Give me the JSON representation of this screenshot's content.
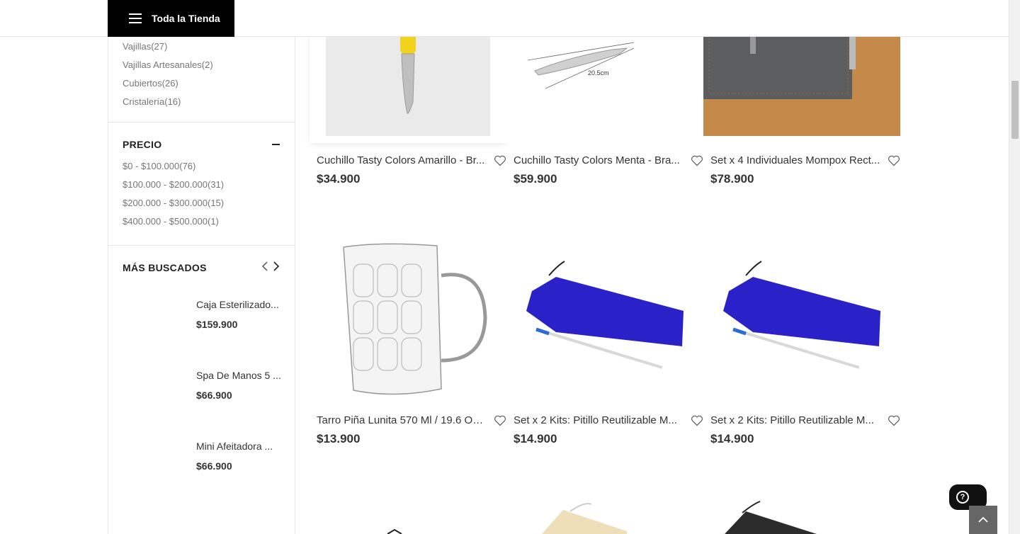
{
  "header": {
    "store_button": "Toda la Tienda"
  },
  "categories": [
    {
      "name": "Vajillas",
      "count": "(27)"
    },
    {
      "name": "Vajillas Artesanales",
      "count": "(2)"
    },
    {
      "name": "Cubiertos",
      "count": "(26)"
    },
    {
      "name": "Cristalería",
      "count": "(16)"
    }
  ],
  "price_filter": {
    "title": "PRECIO",
    "ranges": [
      {
        "label": "$0 - $100.000",
        "count": "(76)"
      },
      {
        "label": "$100.000 - $200.000",
        "count": "(31)"
      },
      {
        "label": "$200.000 - $300.000",
        "count": "(15)"
      },
      {
        "label": "$400.000 - $500.000",
        "count": "(1)"
      }
    ]
  },
  "most_searched": {
    "title": "MÁS BUSCADOS",
    "items": [
      {
        "name": "Caja Esterilizado...",
        "price": "$159.900"
      },
      {
        "name": "Spa De Manos 5 ...",
        "price": "$66.900"
      },
      {
        "name": "Mini Afeitadora ...",
        "price": "$66.900"
      }
    ]
  },
  "products": [
    {
      "name": "Cuchillo Tasty Colors Amarillo - Br...",
      "price": "$34.900"
    },
    {
      "name": "Cuchillo Tasty Colors Menta - Bra...",
      "price": "$59.900"
    },
    {
      "name": "Set x 4 Individuales Mompox Rect...",
      "price": "$78.900"
    },
    {
      "name": "Tarro Piña Lunita 570 Ml / 19.6 Oz...",
      "price": "$13.900"
    },
    {
      "name": "Set x 2 Kits: Pitillo Reutilizable M...",
      "price": "$14.900"
    },
    {
      "name": "Set x 2 Kits: Pitillo Reutilizable M...",
      "price": "$14.900"
    }
  ],
  "knife_label": "20.5cm",
  "help": {
    "icon_text": "?"
  }
}
